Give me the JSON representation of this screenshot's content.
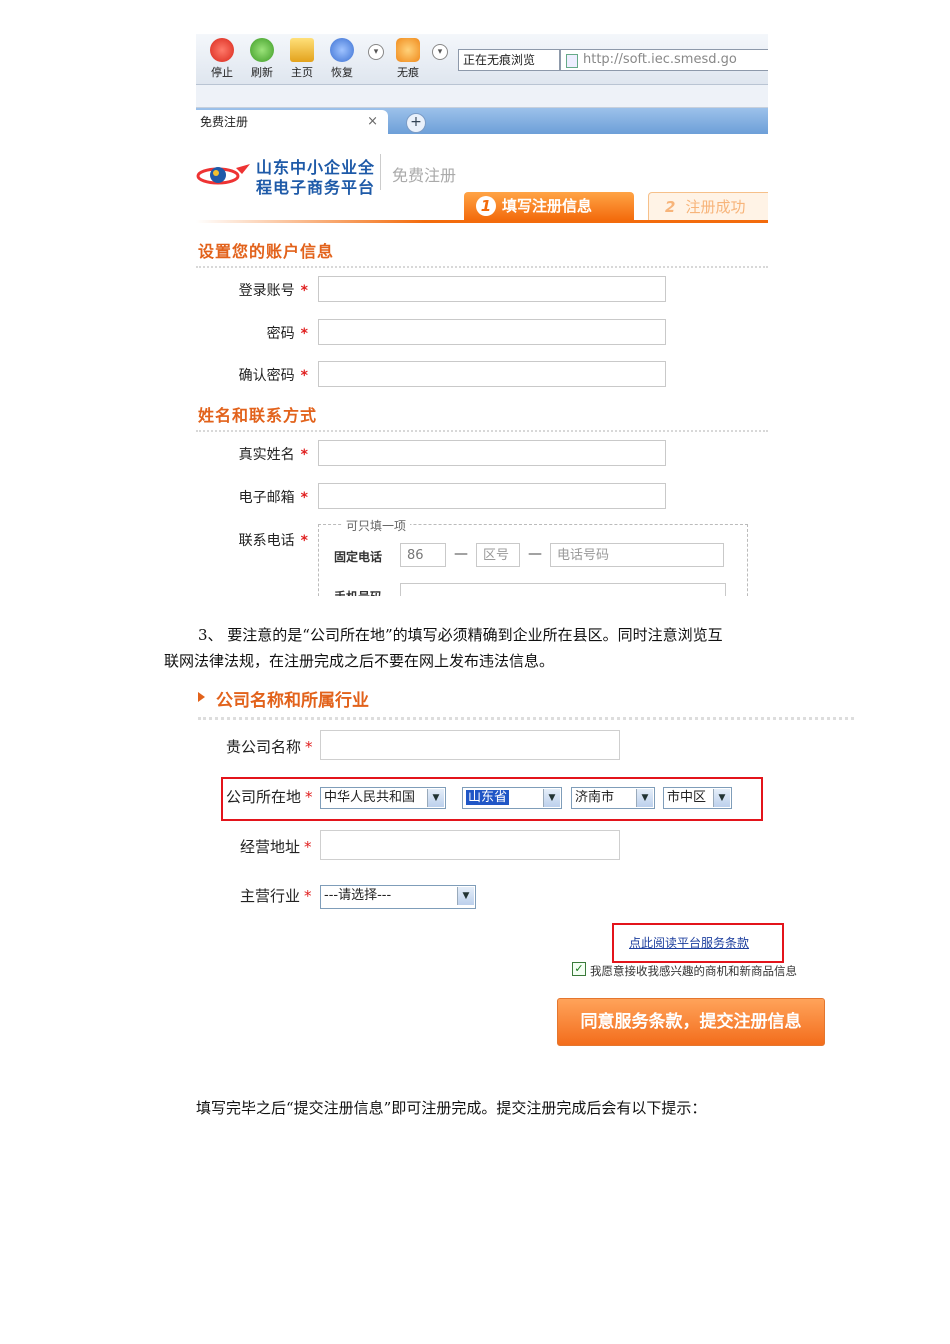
{
  "screenshot1": {
    "toolbar": {
      "buttons": [
        "停止",
        "刷新",
        "主页",
        "恢复",
        "无痕"
      ],
      "inprivate_label": "正在无痕浏览",
      "address": "http://soft.iec.smesd.go"
    },
    "tab": {
      "title": "免费注册",
      "close": "×",
      "new": "+"
    },
    "site": {
      "logo_line1": "山东中小企业全",
      "logo_line2": "程电子商务平台",
      "page_title": "免费注册"
    },
    "steps": [
      {
        "num": "1",
        "label": "填写注册信息"
      },
      {
        "num": "2",
        "label": "注册成功"
      }
    ],
    "section_account": {
      "title": "设置您的账户信息",
      "fields": [
        "登录账号",
        "密码",
        "确认密码"
      ]
    },
    "section_contact": {
      "title": "姓名和联系方式",
      "fields": [
        "真实姓名",
        "电子邮箱",
        "联系电话"
      ],
      "phone_legend": "可只填一项",
      "fixed_label": "固定电话",
      "country_code": "86",
      "area_placeholder": "区号",
      "number_placeholder": "电话号码",
      "mobile_label": "手机号码"
    },
    "required_mark": "*",
    "dash": "—"
  },
  "paragraph1": {
    "line1": "3、  要注意的是“公司所在地”的填写必须精确到企业所在县区。同时注意浏览互",
    "line2": "联网法律法规，在注册完成之后不要在网上发布违法信息。"
  },
  "screenshot2": {
    "section_title": "公司名称和所属行业",
    "labels": {
      "company_name": "贵公司名称",
      "location": "公司所在地",
      "address": "经营地址",
      "industry": "主营行业"
    },
    "location_selects": {
      "country": "中华人民共和国",
      "province": "山东省",
      "city": "济南市",
      "district": "市中区"
    },
    "industry_select": "---请选择---",
    "terms_link": "点此阅读平台服务条款",
    "agree_text": "我愿意接收我感兴趣的商机和新商品信息",
    "submit": "同意服务条款，提交注册信息",
    "required_mark": "*"
  },
  "paragraph2": "填写完毕之后“提交注册信息”即可注册完成。提交注册完成后会有以下提示："
}
